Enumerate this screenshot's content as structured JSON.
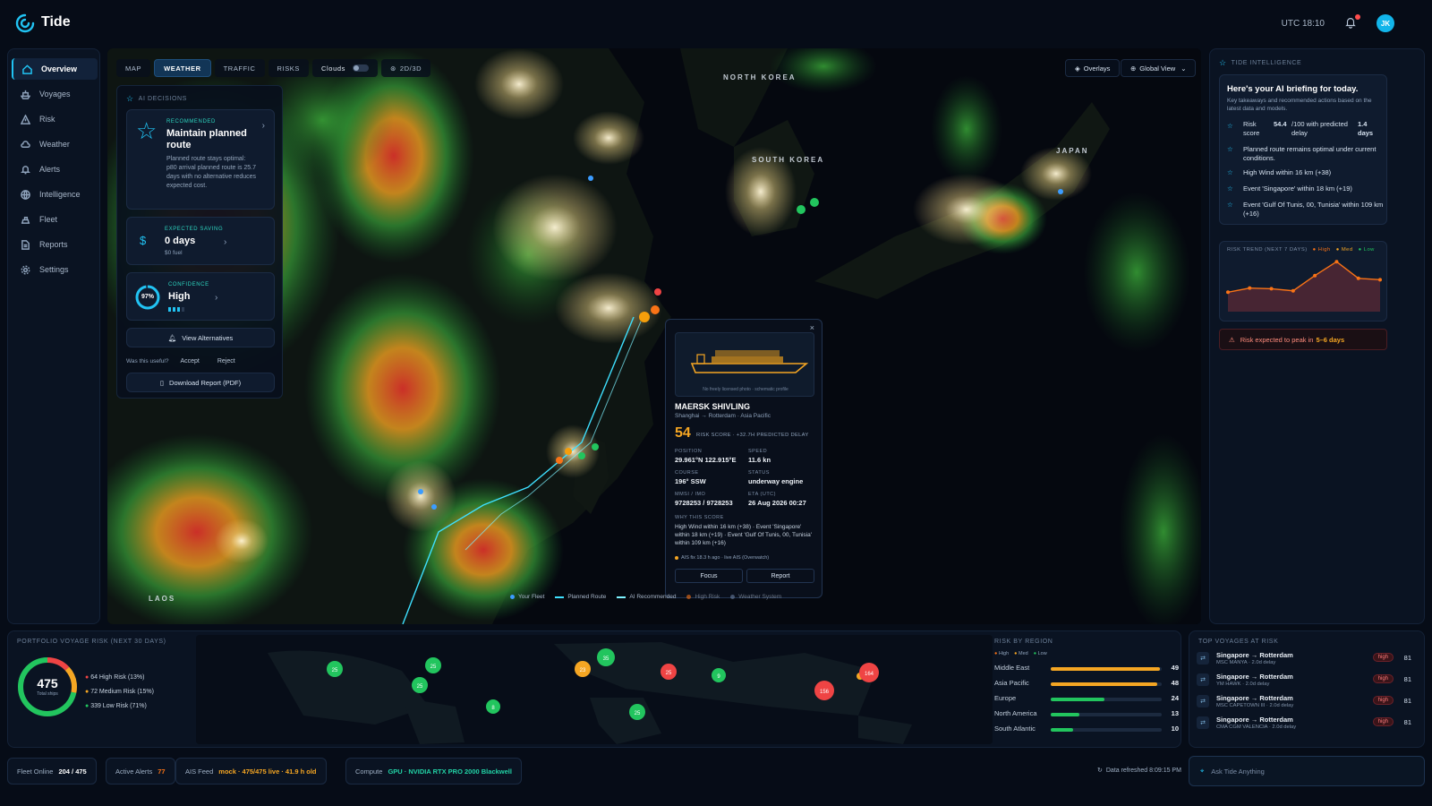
{
  "app": {
    "title": "Tide",
    "utc_time": "UTC 18:10",
    "user_initials": "JK"
  },
  "sidebar": {
    "items": [
      {
        "label": "Overview",
        "icon": "home-icon"
      },
      {
        "label": "Voyages",
        "icon": "ship-icon"
      },
      {
        "label": "Risk",
        "icon": "warning-icon"
      },
      {
        "label": "Weather",
        "icon": "cloud-icon"
      },
      {
        "label": "Alerts",
        "icon": "bell-icon"
      },
      {
        "label": "Intelligence",
        "icon": "globe-icon"
      },
      {
        "label": "Fleet",
        "icon": "fleet-icon"
      },
      {
        "label": "Reports",
        "icon": "document-icon"
      },
      {
        "label": "Settings",
        "icon": "gear-icon"
      }
    ],
    "active": "Overview"
  },
  "map": {
    "tabs": [
      "MAP",
      "WEATHER",
      "TRAFFIC",
      "RISKS"
    ],
    "active_tab": "WEATHER",
    "clouds_label": "Clouds",
    "view_toggle": "2D/3D",
    "overlays_label": "Overlays",
    "global_view_label": "Global View",
    "regions": {
      "north_korea": "NORTH KOREA",
      "south_korea": "SOUTH KOREA",
      "japan": "JAPAN",
      "laos": "LAOS"
    },
    "legend": [
      "Your Fleet",
      "Planned Route",
      "AI Recommended",
      "High Risk",
      "Weather System"
    ]
  },
  "ai_decisions": {
    "header": "AI DECISIONS",
    "recommended": {
      "tag": "RECOMMENDED",
      "title": "Maintain planned route",
      "body": "Planned route stays optimal: p80 arrival planned route is 25.7 days with no alternative reduces expected cost."
    },
    "saving": {
      "tag": "EXPECTED SAVING",
      "value": "0 days",
      "sub": "$0 fuel"
    },
    "confidence": {
      "tag": "CONFIDENCE",
      "value": "High",
      "percent_label": "97%",
      "percent": 97
    },
    "view_alternatives": "View Alternatives",
    "useful_q": "Was this useful?",
    "accept": "Accept",
    "reject": "Reject",
    "download": "Download Report (PDF)"
  },
  "vessel": {
    "photo_caption": "No freely licensed photo · schematic profile",
    "name": "MAERSK SHIVLING",
    "route": "Shanghai → Rotterdam · Asia Pacific",
    "risk_score": "54",
    "risk_label": "RISK SCORE · +32.7H PREDICTED DELAY",
    "position_label": "POSITION",
    "position": "29.961°N 122.915°E",
    "speed_label": "SPEED",
    "speed": "11.6 kn",
    "course_label": "COURSE",
    "course": "196° SSW",
    "status_label": "STATUS",
    "status": "underway engine",
    "mmsi_label": "MMSI / IMO",
    "mmsi": "9728253 / 9728253",
    "eta_label": "ETA (UTC)",
    "eta": "26 Aug 2026 00:27",
    "why_label": "WHY THIS SCORE",
    "why": "High Wind within 16 km (+38) · Event 'Singapore' within 18 km (+19) · Event 'Gulf Of Tunis, 00, Tunisia' within 109 km (+16)",
    "ais_fix": "AIS fix 18.3 h ago · live AIS (Overwatch)",
    "focus": "Focus",
    "report": "Report"
  },
  "intelligence": {
    "header": "TIDE INTELLIGENCE",
    "title": "Here's your AI briefing for today.",
    "subtitle": "Key takeaways and recommended actions based on the latest data and models.",
    "risk_label": "Risk score",
    "risk_value": "54.4",
    "risk_mid": "/100 with predicted delay",
    "risk_days": "1.4 days",
    "bullets": [
      "Planned route remains optimal under current conditions.",
      "High Wind within 16 km (+38)",
      "Event 'Singapore' within 18 km (+19)",
      "Event 'Gulf Of Tunis, 00, Tunisia' within 109 km (+16)"
    ],
    "trend_title": "RISK TREND (NEXT 7 DAYS)",
    "trend_legend": [
      "High",
      "Med",
      "Low"
    ],
    "trend_values": [
      28,
      34,
      33,
      30,
      52,
      72,
      48,
      46
    ],
    "alert_text": "Risk expected to peak in",
    "alert_highlight": "5–6 days"
  },
  "portfolio": {
    "title": "PORTFOLIO VOYAGE RISK (NEXT 30 DAYS)",
    "total": "475",
    "total_label": "Total ships",
    "legend": [
      "64 High Risk (13%)",
      "72 Medium Risk (15%)",
      "339 Low Risk (71%)"
    ],
    "share_pct": [
      13,
      15,
      71
    ],
    "clusters": [
      "25",
      "25",
      "25",
      "8",
      "35",
      "23",
      "25",
      "9",
      "25",
      "156",
      "164"
    ],
    "region_title": "RISK BY REGION",
    "region_legend": [
      "High",
      "Med",
      "Low"
    ],
    "regions": [
      {
        "name": "Middle East",
        "value": "49",
        "ratio": 0.49
      },
      {
        "name": "Asia Pacific",
        "value": "48",
        "ratio": 0.48
      },
      {
        "name": "Europe",
        "value": "24",
        "ratio": 0.24
      },
      {
        "name": "North America",
        "value": "13",
        "ratio": 0.13
      },
      {
        "name": "South Atlantic",
        "value": "10",
        "ratio": 0.1
      }
    ]
  },
  "top_voyages": {
    "title": "TOP VOYAGES AT RISK",
    "rows": [
      {
        "route": "Singapore → Rotterdam",
        "sub": "MSC MANYA · 2.0d delay",
        "badge": "high",
        "score": "81"
      },
      {
        "route": "Singapore → Rotterdam",
        "sub": "YM HAWK · 2.0d delay",
        "badge": "high",
        "score": "81"
      },
      {
        "route": "Singapore → Rotterdam",
        "sub": "MSC CAPETOWN III · 2.0d delay",
        "badge": "high",
        "score": "81"
      },
      {
        "route": "Singapore → Rotterdam",
        "sub": "CMA CGM VALENCIA · 2.0d delay",
        "badge": "high",
        "score": "81"
      }
    ]
  },
  "status": {
    "fleet_label": "Fleet Online",
    "fleet_value": "204 / 475",
    "alerts_label": "Active Alerts",
    "alerts_value": "77",
    "ais_label": "AIS Feed",
    "ais_value": "mock · 475/475 live · 41.9 h old",
    "compute_label": "Compute",
    "compute_value": "GPU · NVIDIA RTX PRO 2000 Blackwell",
    "refreshed": "Data refreshed 8:09:15 PM",
    "ask_placeholder": "Ask Tide Anything"
  },
  "colors": {
    "accent": "#21c3f3",
    "high": "#ef4444",
    "medium": "#f5a623",
    "low": "#22c55e",
    "route": "#3ee0ff"
  }
}
